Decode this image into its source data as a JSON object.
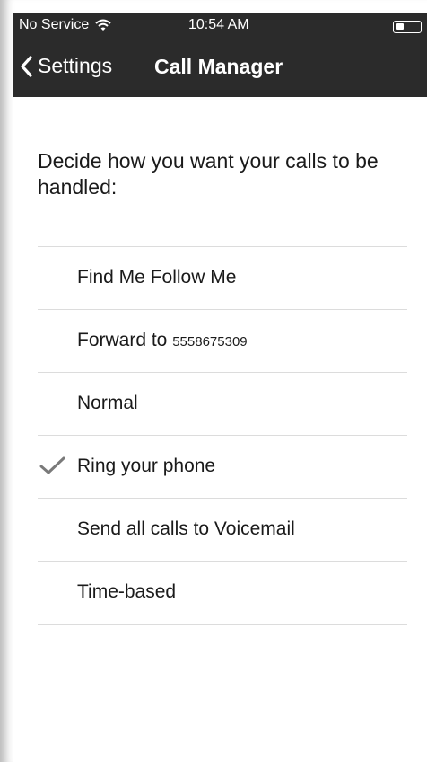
{
  "status_bar": {
    "carrier": "No Service",
    "time": "10:54 AM",
    "icons": [
      "wifi-icon",
      "battery-icon"
    ]
  },
  "nav_bar": {
    "back_label": "Settings",
    "back_icon": "chevron-left-icon",
    "title": "Call Manager",
    "background": "#2b2b2b"
  },
  "main": {
    "instruction": "Decide how you want your calls to be handled:",
    "options": [
      {
        "label": "Find Me Follow Me",
        "selected": false
      },
      {
        "label": "Forward to",
        "number": "5558675309",
        "selected": false
      },
      {
        "label": "Normal",
        "selected": false
      },
      {
        "label": "Ring your phone",
        "selected": true
      },
      {
        "label": "Send all calls to Voicemail",
        "selected": false
      },
      {
        "label": "Time-based",
        "selected": false
      }
    ],
    "selected_icon": "checkmark-icon",
    "checkmark_color": "#7a7a7a"
  }
}
